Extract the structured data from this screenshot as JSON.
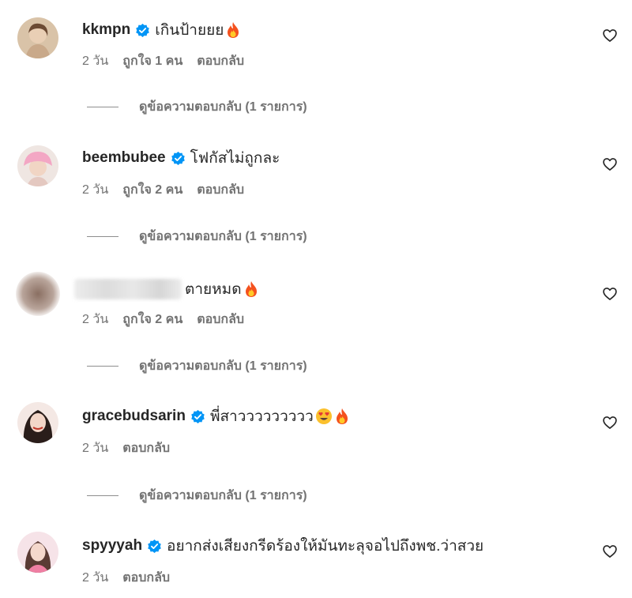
{
  "comments": [
    {
      "username": "kkmpn",
      "verified": true,
      "text": "เกินป้ายยย",
      "emojis": [
        "fire-emoji"
      ],
      "time": "2 วัน",
      "likes": "ถูกใจ 1 คน",
      "reply_label": "ตอบกลับ",
      "view_replies": "ดูข้อความตอบกลับ (1 รายการ)"
    },
    {
      "username": "beembubee",
      "verified": true,
      "text": "โฟกัสไม่ถูกละ",
      "emojis": [],
      "time": "2 วัน",
      "likes": "ถูกใจ 2 คน",
      "reply_label": "ตอบกลับ",
      "view_replies": "ดูข้อความตอบกลับ (1 รายการ)"
    },
    {
      "username": "",
      "verified": false,
      "text": "ตายหมด",
      "emojis": [
        "fire-emoji"
      ],
      "time": "2 วัน",
      "likes": "ถูกใจ 2 คน",
      "reply_label": "ตอบกลับ",
      "view_replies": "ดูข้อความตอบกลับ (1 รายการ)"
    },
    {
      "username": "gracebudsarin",
      "verified": true,
      "text": "พี่สาววววววววว",
      "emojis": [
        "heart-eyes-emoji",
        "fire-emoji"
      ],
      "time": "2 วัน",
      "likes": "",
      "reply_label": "ตอบกลับ",
      "view_replies": "ดูข้อความตอบกลับ (1 รายการ)"
    },
    {
      "username": "spyyyah",
      "verified": true,
      "text": "อยากส่งเสียงกรีดร้องให้มันทะลุจอไปถึงพช.ว่าสวย",
      "emojis": [],
      "time": "2 วัน",
      "likes": "",
      "reply_label": "ตอบกลับ",
      "view_replies": ""
    }
  ],
  "icons": {
    "verified": "verified-badge-icon",
    "like": "heart-outline-icon"
  },
  "colors": {
    "verified_blue": "#0095f6",
    "secondary_text": "#737373",
    "primary_text": "#262626"
  }
}
